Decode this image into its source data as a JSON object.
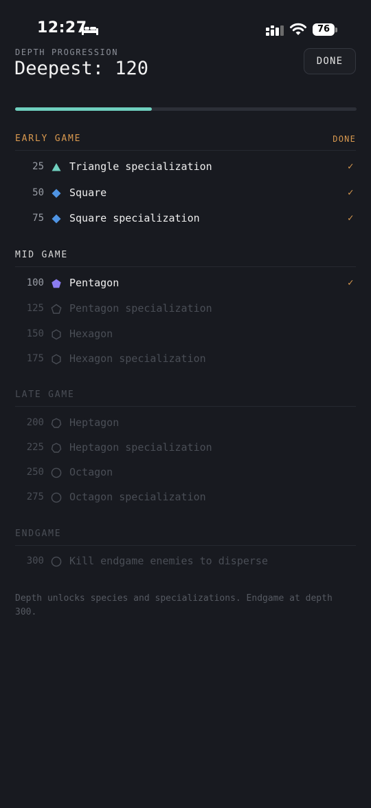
{
  "status_bar": {
    "time": "12:27",
    "battery": "76"
  },
  "header": {
    "subtitle": "DEPTH PROGRESSION",
    "title": "Deepest: 120",
    "done_label": "DONE"
  },
  "progress": {
    "fraction": 0.4
  },
  "colors": {
    "accent_progress": "#6fcfbe",
    "done_orange": "#d9994f",
    "triangle": "#6fcfbe",
    "square": "#4f94e3",
    "pentagon": "#8b7cf0",
    "locked": "#4a4e56"
  },
  "sections": [
    {
      "title": "EARLY GAME",
      "status": "DONE",
      "rows": [
        {
          "depth": "25",
          "icon": "triangle-icon",
          "label": "Triangle specialization",
          "check": "✓"
        },
        {
          "depth": "50",
          "icon": "square-icon",
          "label": "Square",
          "check": "✓"
        },
        {
          "depth": "75",
          "icon": "square-icon",
          "label": "Square specialization",
          "check": "✓"
        }
      ]
    },
    {
      "title": "MID GAME",
      "rows": [
        {
          "depth": "100",
          "icon": "pentagon-icon",
          "label": "Pentagon",
          "check": "✓"
        },
        {
          "depth": "125",
          "icon": "pentagon-outline-icon",
          "label": "Pentagon specialization"
        },
        {
          "depth": "150",
          "icon": "hexagon-outline-icon",
          "label": "Hexagon"
        },
        {
          "depth": "175",
          "icon": "hexagon-outline-icon",
          "label": "Hexagon specialization"
        }
      ]
    },
    {
      "title": "LATE GAME",
      "rows": [
        {
          "depth": "200",
          "icon": "heptagon-outline-icon",
          "label": "Heptagon"
        },
        {
          "depth": "225",
          "icon": "heptagon-outline-icon",
          "label": "Heptagon specialization"
        },
        {
          "depth": "250",
          "icon": "octagon-outline-icon",
          "label": "Octagon"
        },
        {
          "depth": "275",
          "icon": "octagon-outline-icon",
          "label": "Octagon specialization"
        }
      ]
    },
    {
      "title": "ENDGAME",
      "rows": [
        {
          "depth": "300",
          "icon": "circle-outline-icon",
          "label": "Kill endgame enemies to disperse"
        }
      ]
    }
  ],
  "footer": {
    "note": "Depth unlocks species and specializations. Endgame at depth 300."
  }
}
